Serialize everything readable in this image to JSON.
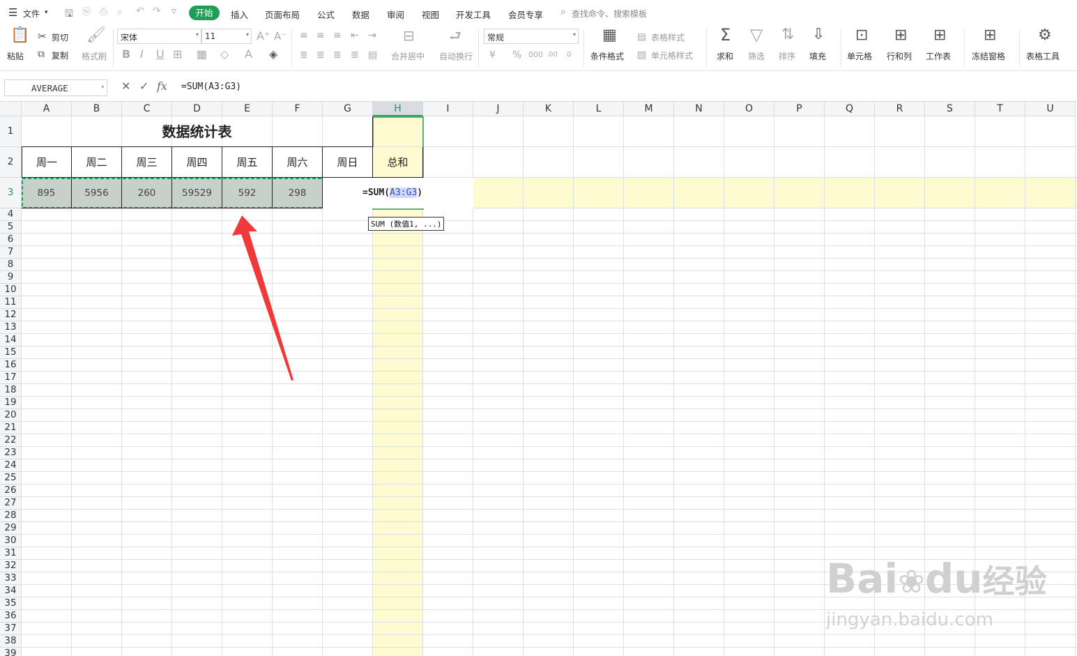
{
  "menubar": {
    "file_label": "文件",
    "tabs": [
      "开始",
      "插入",
      "页面布局",
      "公式",
      "数据",
      "审阅",
      "视图",
      "开发工具",
      "会员专享"
    ],
    "search_placeholder": "查找命令、搜索模板"
  },
  "ribbon": {
    "paste": "粘贴",
    "cut": "剪切",
    "copy": "复制",
    "format_painter": "格式刷",
    "font_name": "宋体",
    "font_size": "11",
    "merge_center": "合并居中",
    "wrap_text": "自动换行",
    "number_format": "常规",
    "conditional_format": "条件格式",
    "table_style": "表格样式",
    "cell_style": "单元格样式",
    "sum": "求和",
    "filter": "筛选",
    "sort": "排序",
    "fill": "填充",
    "cell": "单元格",
    "row_col": "行和列",
    "worksheet": "工作表",
    "freeze": "冻结窗格",
    "table_tools": "表格工具"
  },
  "formula_bar": {
    "name_box": "AVERAGE",
    "fx_label": "fx",
    "formula": "=SUM(A3:G3)"
  },
  "sheet": {
    "columns": [
      "A",
      "B",
      "C",
      "D",
      "E",
      "F",
      "G",
      "H",
      "I",
      "J",
      "K",
      "L",
      "M",
      "N",
      "O",
      "P",
      "Q",
      "R",
      "S",
      "T",
      "U"
    ],
    "rows": [
      "1",
      "2",
      "3",
      "4",
      "5",
      "6",
      "7",
      "8",
      "9",
      "10",
      "11",
      "12",
      "13",
      "14",
      "15",
      "16",
      "17",
      "18",
      "19",
      "20",
      "21",
      "22",
      "23",
      "24",
      "25",
      "26",
      "27",
      "28",
      "29",
      "30",
      "31",
      "32",
      "33",
      "34",
      "35",
      "36",
      "37",
      "38",
      "39"
    ],
    "title": "数据统计表",
    "headers": [
      "周一",
      "周二",
      "周三",
      "周四",
      "周五",
      "周六",
      "周日",
      "总和"
    ],
    "values": [
      "895",
      "5956",
      "260",
      "59529",
      "592",
      "298"
    ],
    "editing_cell": {
      "prefix": "=SUM(",
      "ref": "A3:G3",
      "suffix": ")"
    },
    "tooltip": "SUM (数值1, ...)"
  },
  "watermark": {
    "logo": "Bai",
    "logo2": "du",
    "brand": "经验",
    "url": "jingyan.baidu.com"
  },
  "colors": {
    "accent": "#1f9e57",
    "highlight": "#fffbd0",
    "selection": "#c8d0ca",
    "arrow": "#f03a3a"
  }
}
